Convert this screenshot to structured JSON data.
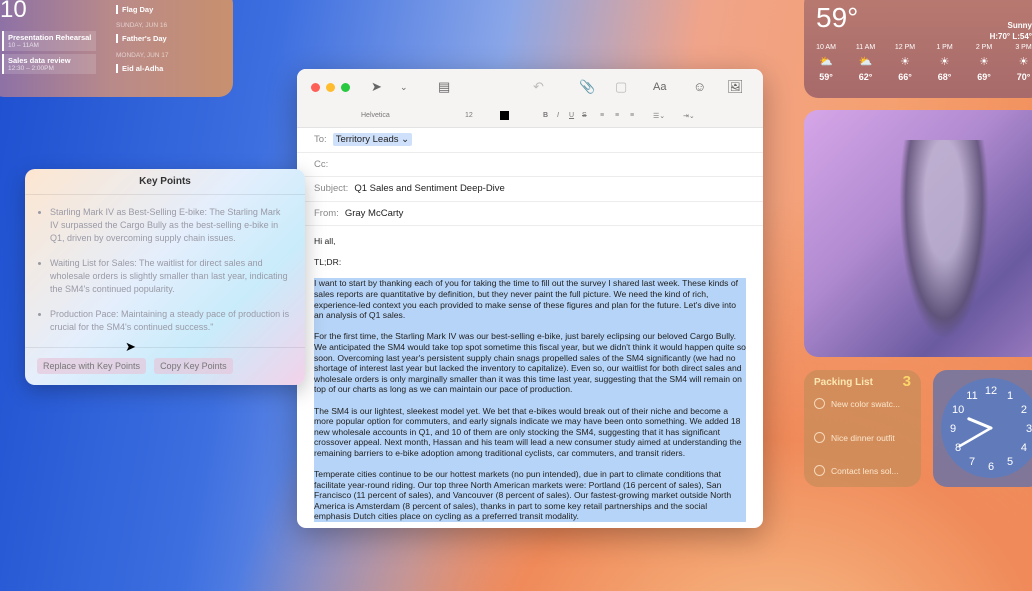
{
  "calendar": {
    "day": "10",
    "events": [
      {
        "title": "Presentation Rehearsal",
        "time": "10 – 11AM"
      },
      {
        "title": "Sales data review",
        "time": "12:30 – 2:00PM"
      }
    ],
    "holidays": [
      {
        "header": "",
        "name": "Flag Day"
      },
      {
        "header": "SUNDAY, JUN 16",
        "name": "Father's Day"
      },
      {
        "header": "MONDAY, JUN 17",
        "name": "Eid al-Adha"
      }
    ]
  },
  "weather": {
    "temp": "59°",
    "condition": "Sunny",
    "hilo": "H:70° L:54°",
    "hours": [
      {
        "t": "10 AM",
        "icon": "partly-cloudy-icon",
        "v": "59°"
      },
      {
        "t": "11 AM",
        "icon": "partly-cloudy-icon",
        "v": "62°"
      },
      {
        "t": "12 PM",
        "icon": "sun-icon",
        "v": "66°"
      },
      {
        "t": "1 PM",
        "icon": "sun-icon",
        "v": "68°"
      },
      {
        "t": "2 PM",
        "icon": "sun-icon",
        "v": "69°"
      },
      {
        "t": "3 PM",
        "icon": "sun-icon",
        "v": "70°"
      }
    ]
  },
  "packing": {
    "title": "Packing List",
    "count": "3",
    "items": [
      "New color swatc...",
      "Nice dinner outfit",
      "Contact lens sol..."
    ]
  },
  "clock": {
    "numbers": [
      "12",
      "1",
      "2",
      "3",
      "4",
      "5",
      "6",
      "7",
      "8",
      "9",
      "10",
      "11"
    ],
    "hour": 9.75,
    "minute": 40
  },
  "mail": {
    "format": {
      "font": "Helvetica",
      "size": "12"
    },
    "to_label": "To:",
    "to": "Territory Leads",
    "cc_label": "Cc:",
    "subject_label": "Subject:",
    "subject": "Q1 Sales and Sentiment Deep-Dive",
    "from_label": "From:",
    "from": "Gray McCarty",
    "greeting": "Hi all,",
    "tldr": "TL;DR:",
    "paragraphs": [
      "I want to start by thanking each of you for taking the time to fill out the survey I shared last week. These kinds of sales reports are quantitative by definition, but they never paint the full picture. We need the kind of rich, experience-led context you each provided to make sense of these figures and plan for the future. Let's dive into an analysis of Q1 sales.",
      "For the first time, the Starling Mark IV was our best-selling e-bike, just barely eclipsing our beloved Cargo Bully. We anticipated the SM4 would take top spot sometime this fiscal year, but we didn't think it would happen quite so soon. Overcoming last year's persistent supply chain snags propelled sales of the SM4 significantly (we had no shortage of interest last year but lacked the inventory to capitalize). Even so, our waitlist for both direct sales and wholesale orders is only marginally smaller than it was this time last year, suggesting that the SM4 will remain on top of our charts as long as we can maintain our pace of production.",
      "The SM4 is our lightest, sleekest model yet. We bet that e-bikes would break out of their niche and become a more popular option for commuters, and early signals indicate we may have been onto something. We added 18 new wholesale accounts in Q1, and 10 of them are only stocking the SM4, suggesting that it has significant crossover appeal. Next month, Hassan and his team will lead a new consumer study aimed at understanding the remaining barriers to e-bike adoption among traditional cyclists, car commuters, and transit riders.",
      "Temperate cities continue to be our hottest markets (no pun intended), due in part to climate conditions that facilitate year-round riding. Our top three North American markets were: Portland (16 percent of sales), San Francisco (11 percent of sales), and Vancouver (8 percent of sales). Our fastest-growing market outside North America is Amsterdam (8 percent of sales), thanks in part to some key retail partnerships and the social emphasis Dutch cities place on cycling as a preferred transit modality."
    ]
  },
  "keypoints": {
    "title": "Key Points",
    "items": [
      "Starling Mark IV as Best-Selling E-bike: The Starling Mark IV surpassed the Cargo Bully as the best-selling e-bike in Q1, driven by overcoming supply chain issues.",
      "Waiting List for Sales: The waitlist for direct sales and wholesale orders is slightly smaller than last year, indicating the SM4's continued popularity.",
      "Production Pace: Maintaining a steady pace of production is crucial for the SM4's continued success.\""
    ],
    "replace_label": "Replace with Key Points",
    "copy_label": "Copy Key Points"
  }
}
